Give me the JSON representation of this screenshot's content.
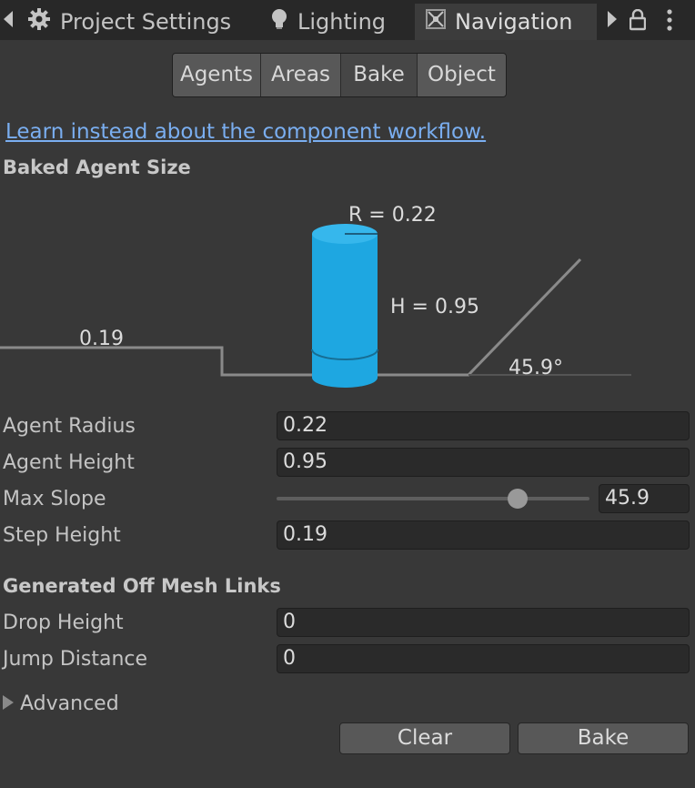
{
  "tabs": [
    {
      "label": "Project Settings",
      "icon": "gear-icon"
    },
    {
      "label": "Lighting",
      "icon": "lightbulb-icon"
    },
    {
      "label": "Navigation",
      "icon": "navigation-icon",
      "active": true
    }
  ],
  "toolbar": {
    "items": [
      "Agents",
      "Areas",
      "Bake",
      "Object"
    ],
    "selected": "Bake"
  },
  "link_text": "Learn instead about the component workflow.",
  "baked_agent_size": {
    "heading": "Baked Agent Size",
    "radius_label": "R = 0.22",
    "height_label": "H = 0.95",
    "step_label": "0.19",
    "slope_label": "45.9°",
    "agent_color": "#1ea7e1"
  },
  "properties": {
    "agent_radius": {
      "label": "Agent Radius",
      "value": "0.22"
    },
    "agent_height": {
      "label": "Agent Height",
      "value": "0.95"
    },
    "max_slope": {
      "label": "Max Slope",
      "value": "45.9",
      "slider_fraction": 0.77
    },
    "step_height": {
      "label": "Step Height",
      "value": "0.19"
    }
  },
  "offmesh": {
    "heading": "Generated Off Mesh Links",
    "drop_height": {
      "label": "Drop Height",
      "value": "0"
    },
    "jump_distance": {
      "label": "Jump Distance",
      "value": "0"
    }
  },
  "advanced_label": "Advanced",
  "buttons": {
    "clear": "Clear",
    "bake": "Bake"
  }
}
